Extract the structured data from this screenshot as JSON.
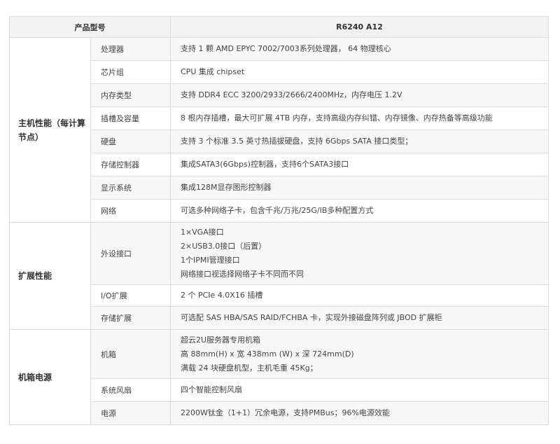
{
  "header": {
    "model_label": "产品型号",
    "model_value": "R6240 A12"
  },
  "groups": [
    {
      "label": "主机性能（每计算节点）",
      "rows": [
        {
          "name": "处理器",
          "lines": [
            "支持 1 颗 AMD EPYC 7002/7003系列处理器， 64 物理核心"
          ]
        },
        {
          "name": "芯片组",
          "lines": [
            "CPU 集成 chipset"
          ]
        },
        {
          "name": "内存类型",
          "lines": [
            "支持 DDR4 ECC 3200/2933/2666/2400MHz，内存电压 1.2V"
          ]
        },
        {
          "name": "插槽及容量",
          "lines": [
            "8 根内存插槽，最大可扩展 4TB 内存，支持高级内存纠错、内存镜像、内存热备等高级功能"
          ]
        },
        {
          "name": "硬盘",
          "lines": [
            "支持 3 个标准 3.5 英寸热插拔硬盘，支持 6Gbps SATA 接口类型；"
          ]
        },
        {
          "name": "存储控制器",
          "lines": [
            "集成SATA3(6Gbps)控制器，支持6个SATA3接口"
          ]
        },
        {
          "name": "显示系统",
          "lines": [
            "集成128M显存图形控制器"
          ]
        },
        {
          "name": "网络",
          "lines": [
            "可选多种网络子卡，包含千兆/万兆/25G/IB多种配置方式"
          ]
        }
      ]
    },
    {
      "label": "扩展性能",
      "rows": [
        {
          "name": "外设接口",
          "lines": [
            "1×VGA接口",
            "2×USB3.0接口（后置）",
            "1个IPMI管理接口",
            "网络接口视选择网络子卡不同而不同"
          ]
        },
        {
          "name": "I/O扩展",
          "lines": [
            "2 个 PCIe 4.0X16 插槽"
          ]
        },
        {
          "name": "存储扩展",
          "lines": [
            "可选配 SAS HBA/SAS RAID/FCHBA 卡，实现外接磁盘阵列或 JBOD 扩展柜"
          ]
        }
      ]
    },
    {
      "label": "机箱电源",
      "rows": [
        {
          "name": "机箱",
          "lines": [
            "超云2U服务器专用机箱",
            "高 88mm(H) x 宽 438mm (W) x 深 724mm(D)",
            "满载 24 块硬盘机型，主机毛重 45Kg；"
          ]
        },
        {
          "name": "系统风扇",
          "lines": [
            "四个智能控制风扇"
          ]
        },
        {
          "name": "电源",
          "lines": [
            "2200W钛金（1+1）冗余电源，支持PMBus；96%电源效能"
          ]
        }
      ]
    }
  ]
}
